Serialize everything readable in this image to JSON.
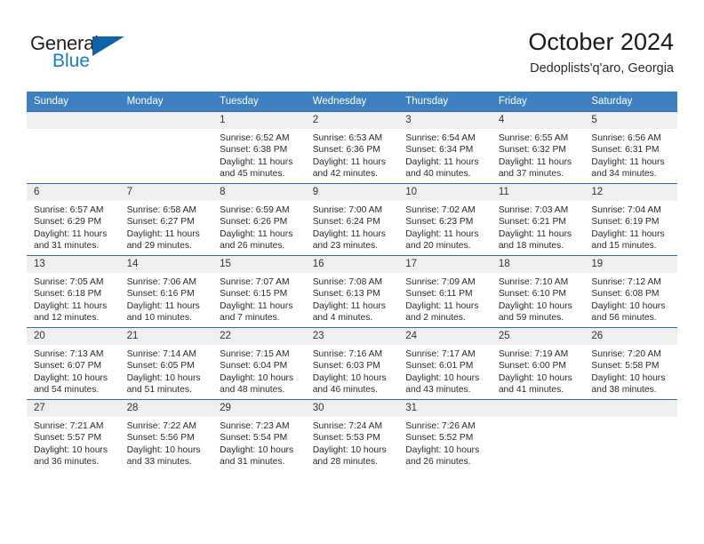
{
  "brand": {
    "word_one": "General",
    "word_two": "Blue",
    "accent_color": "#1262a6",
    "blue_text_color": "#1a7fc1",
    "triangle_icon": "triangle-icon"
  },
  "header": {
    "title": "October 2024",
    "subtitle": "Dedoplists'q'aro, Georgia"
  },
  "theme": {
    "header_row_bg": "#3d7fbf",
    "daynum_bg": "#efefef",
    "grid_line": "#2e6da4"
  },
  "calendar": {
    "weekday_headers": [
      "Sunday",
      "Monday",
      "Tuesday",
      "Wednesday",
      "Thursday",
      "Friday",
      "Saturday"
    ],
    "weeks": [
      [
        {
          "day": "",
          "lines": []
        },
        {
          "day": "",
          "lines": []
        },
        {
          "day": "1",
          "lines": [
            "Sunrise: 6:52 AM",
            "Sunset: 6:38 PM",
            "Daylight: 11 hours",
            "and 45 minutes."
          ]
        },
        {
          "day": "2",
          "lines": [
            "Sunrise: 6:53 AM",
            "Sunset: 6:36 PM",
            "Daylight: 11 hours",
            "and 42 minutes."
          ]
        },
        {
          "day": "3",
          "lines": [
            "Sunrise: 6:54 AM",
            "Sunset: 6:34 PM",
            "Daylight: 11 hours",
            "and 40 minutes."
          ]
        },
        {
          "day": "4",
          "lines": [
            "Sunrise: 6:55 AM",
            "Sunset: 6:32 PM",
            "Daylight: 11 hours",
            "and 37 minutes."
          ]
        },
        {
          "day": "5",
          "lines": [
            "Sunrise: 6:56 AM",
            "Sunset: 6:31 PM",
            "Daylight: 11 hours",
            "and 34 minutes."
          ]
        }
      ],
      [
        {
          "day": "6",
          "lines": [
            "Sunrise: 6:57 AM",
            "Sunset: 6:29 PM",
            "Daylight: 11 hours",
            "and 31 minutes."
          ]
        },
        {
          "day": "7",
          "lines": [
            "Sunrise: 6:58 AM",
            "Sunset: 6:27 PM",
            "Daylight: 11 hours",
            "and 29 minutes."
          ]
        },
        {
          "day": "8",
          "lines": [
            "Sunrise: 6:59 AM",
            "Sunset: 6:26 PM",
            "Daylight: 11 hours",
            "and 26 minutes."
          ]
        },
        {
          "day": "9",
          "lines": [
            "Sunrise: 7:00 AM",
            "Sunset: 6:24 PM",
            "Daylight: 11 hours",
            "and 23 minutes."
          ]
        },
        {
          "day": "10",
          "lines": [
            "Sunrise: 7:02 AM",
            "Sunset: 6:23 PM",
            "Daylight: 11 hours",
            "and 20 minutes."
          ]
        },
        {
          "day": "11",
          "lines": [
            "Sunrise: 7:03 AM",
            "Sunset: 6:21 PM",
            "Daylight: 11 hours",
            "and 18 minutes."
          ]
        },
        {
          "day": "12",
          "lines": [
            "Sunrise: 7:04 AM",
            "Sunset: 6:19 PM",
            "Daylight: 11 hours",
            "and 15 minutes."
          ]
        }
      ],
      [
        {
          "day": "13",
          "lines": [
            "Sunrise: 7:05 AM",
            "Sunset: 6:18 PM",
            "Daylight: 11 hours",
            "and 12 minutes."
          ]
        },
        {
          "day": "14",
          "lines": [
            "Sunrise: 7:06 AM",
            "Sunset: 6:16 PM",
            "Daylight: 11 hours",
            "and 10 minutes."
          ]
        },
        {
          "day": "15",
          "lines": [
            "Sunrise: 7:07 AM",
            "Sunset: 6:15 PM",
            "Daylight: 11 hours",
            "and 7 minutes."
          ]
        },
        {
          "day": "16",
          "lines": [
            "Sunrise: 7:08 AM",
            "Sunset: 6:13 PM",
            "Daylight: 11 hours",
            "and 4 minutes."
          ]
        },
        {
          "day": "17",
          "lines": [
            "Sunrise: 7:09 AM",
            "Sunset: 6:11 PM",
            "Daylight: 11 hours",
            "and 2 minutes."
          ]
        },
        {
          "day": "18",
          "lines": [
            "Sunrise: 7:10 AM",
            "Sunset: 6:10 PM",
            "Daylight: 10 hours",
            "and 59 minutes."
          ]
        },
        {
          "day": "19",
          "lines": [
            "Sunrise: 7:12 AM",
            "Sunset: 6:08 PM",
            "Daylight: 10 hours",
            "and 56 minutes."
          ]
        }
      ],
      [
        {
          "day": "20",
          "lines": [
            "Sunrise: 7:13 AM",
            "Sunset: 6:07 PM",
            "Daylight: 10 hours",
            "and 54 minutes."
          ]
        },
        {
          "day": "21",
          "lines": [
            "Sunrise: 7:14 AM",
            "Sunset: 6:05 PM",
            "Daylight: 10 hours",
            "and 51 minutes."
          ]
        },
        {
          "day": "22",
          "lines": [
            "Sunrise: 7:15 AM",
            "Sunset: 6:04 PM",
            "Daylight: 10 hours",
            "and 48 minutes."
          ]
        },
        {
          "day": "23",
          "lines": [
            "Sunrise: 7:16 AM",
            "Sunset: 6:03 PM",
            "Daylight: 10 hours",
            "and 46 minutes."
          ]
        },
        {
          "day": "24",
          "lines": [
            "Sunrise: 7:17 AM",
            "Sunset: 6:01 PM",
            "Daylight: 10 hours",
            "and 43 minutes."
          ]
        },
        {
          "day": "25",
          "lines": [
            "Sunrise: 7:19 AM",
            "Sunset: 6:00 PM",
            "Daylight: 10 hours",
            "and 41 minutes."
          ]
        },
        {
          "day": "26",
          "lines": [
            "Sunrise: 7:20 AM",
            "Sunset: 5:58 PM",
            "Daylight: 10 hours",
            "and 38 minutes."
          ]
        }
      ],
      [
        {
          "day": "27",
          "lines": [
            "Sunrise: 7:21 AM",
            "Sunset: 5:57 PM",
            "Daylight: 10 hours",
            "and 36 minutes."
          ]
        },
        {
          "day": "28",
          "lines": [
            "Sunrise: 7:22 AM",
            "Sunset: 5:56 PM",
            "Daylight: 10 hours",
            "and 33 minutes."
          ]
        },
        {
          "day": "29",
          "lines": [
            "Sunrise: 7:23 AM",
            "Sunset: 5:54 PM",
            "Daylight: 10 hours",
            "and 31 minutes."
          ]
        },
        {
          "day": "30",
          "lines": [
            "Sunrise: 7:24 AM",
            "Sunset: 5:53 PM",
            "Daylight: 10 hours",
            "and 28 minutes."
          ]
        },
        {
          "day": "31",
          "lines": [
            "Sunrise: 7:26 AM",
            "Sunset: 5:52 PM",
            "Daylight: 10 hours",
            "and 26 minutes."
          ]
        },
        {
          "day": "",
          "lines": []
        },
        {
          "day": "",
          "lines": []
        }
      ]
    ]
  }
}
